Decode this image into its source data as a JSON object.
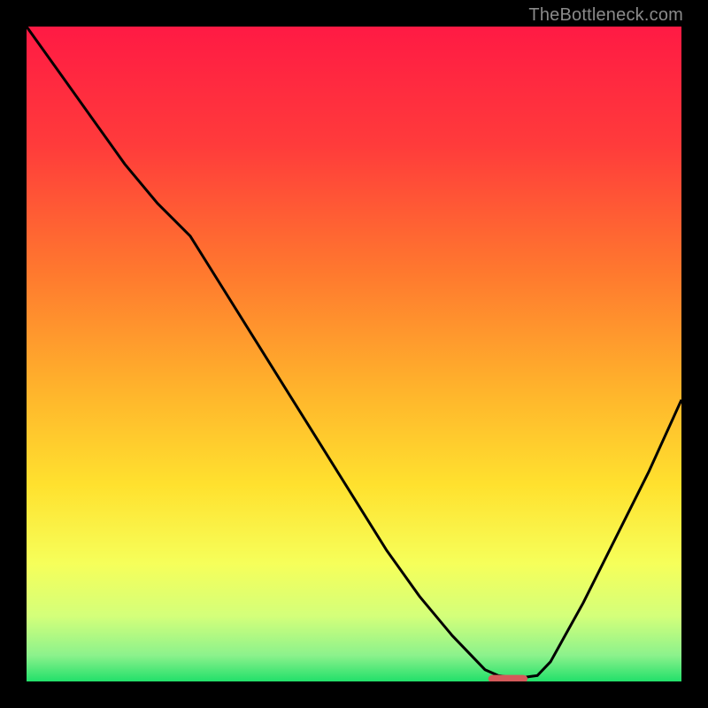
{
  "watermark": "TheBottleneck.com",
  "chart_data": {
    "type": "line",
    "title": "",
    "xlabel": "",
    "ylabel": "",
    "xlim": [
      0,
      100
    ],
    "ylim": [
      0,
      100
    ],
    "x": [
      0,
      5,
      10,
      15,
      20,
      25,
      30,
      35,
      40,
      45,
      50,
      55,
      60,
      65,
      70,
      72,
      75,
      78,
      80,
      85,
      90,
      95,
      100
    ],
    "y": [
      100,
      93,
      86,
      79,
      73,
      68,
      60,
      52,
      44,
      36,
      28,
      20,
      13,
      7,
      1.8,
      0.9,
      0.5,
      0.9,
      3,
      12,
      22,
      32,
      43
    ],
    "gradient_stops": [
      {
        "offset": 0.0,
        "color": "#ff1a44"
      },
      {
        "offset": 0.18,
        "color": "#ff3b3b"
      },
      {
        "offset": 0.38,
        "color": "#ff7a2e"
      },
      {
        "offset": 0.55,
        "color": "#ffb22c"
      },
      {
        "offset": 0.7,
        "color": "#ffe12e"
      },
      {
        "offset": 0.82,
        "color": "#f6ff5a"
      },
      {
        "offset": 0.9,
        "color": "#d4ff7a"
      },
      {
        "offset": 0.96,
        "color": "#8cf28c"
      },
      {
        "offset": 1.0,
        "color": "#22e06a"
      }
    ],
    "marker": {
      "x_center": 73.5,
      "y": 0.4,
      "width": 6.0,
      "height": 1.2,
      "color": "#d45a5a"
    },
    "line_color": "#000000",
    "line_width": 3
  }
}
